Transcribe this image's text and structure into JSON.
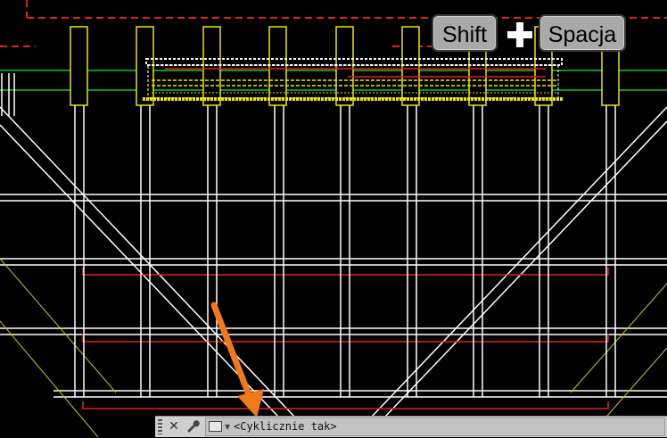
{
  "overlay": {
    "key1": "Shift",
    "plus": "+",
    "key2": "Spacja"
  },
  "command_line": {
    "input_text": "<Cyklicznie tak>"
  },
  "icons": {
    "close": "close-icon",
    "settings": "wrench-icon",
    "prompt": "command-prompt-icon",
    "arrow": "annotation-arrow"
  },
  "colors": {
    "background": "#000000",
    "lines": "#ffffff",
    "red": "#e02020",
    "green": "#20c020",
    "yellow": "#e8e800",
    "arrow": "#f07a1a"
  }
}
